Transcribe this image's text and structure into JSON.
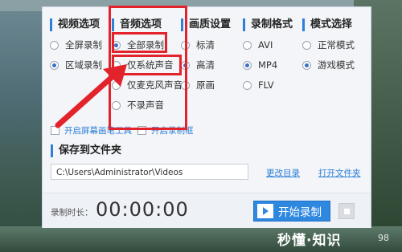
{
  "columns": [
    {
      "title": "视频选项",
      "options": [
        {
          "label": "全屏录制",
          "selected": false
        },
        {
          "label": "区域录制",
          "selected": true
        }
      ]
    },
    {
      "title": "音频选项",
      "options": [
        {
          "label": "全部录制",
          "selected": true
        },
        {
          "label": "仅系统声音",
          "selected": false
        },
        {
          "label": "仅麦克风声音",
          "selected": false
        },
        {
          "label": "不录声音",
          "selected": false
        }
      ]
    },
    {
      "title": "画质设置",
      "options": [
        {
          "label": "标清",
          "selected": false
        },
        {
          "label": "高清",
          "selected": true
        },
        {
          "label": "原画",
          "selected": false
        }
      ]
    },
    {
      "title": "录制格式",
      "options": [
        {
          "label": "AVI",
          "selected": false
        },
        {
          "label": "MP4",
          "selected": true
        },
        {
          "label": "FLV",
          "selected": false
        }
      ]
    },
    {
      "title": "模式选择",
      "options": [
        {
          "label": "正常模式",
          "selected": false
        },
        {
          "label": "游戏模式",
          "selected": true
        }
      ]
    }
  ],
  "checkboxes": [
    {
      "label": "开启屏幕画笔工具",
      "checked": false
    },
    {
      "label": "开启录制框",
      "checked": false
    }
  ],
  "save": {
    "title": "保存到文件夹",
    "path": "C:\\Users\\Administrator\\Videos",
    "change_dir": "更改目录",
    "open_folder": "打开文件夹"
  },
  "footer": {
    "duration_label": "录制时长：",
    "duration_value": "00:00:00",
    "start_button": "开始录制"
  },
  "watermark": {
    "text": "秒懂·知识",
    "number": "98"
  },
  "colors": {
    "accent": "#2e7fd8",
    "button": "#2f88e0",
    "annotation": "#e3232b"
  }
}
